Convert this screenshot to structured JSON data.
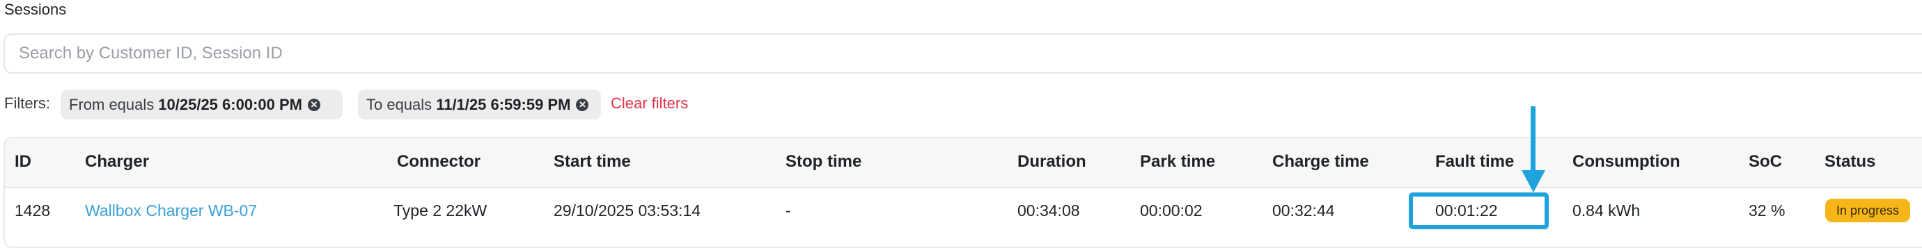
{
  "page": {
    "title": "Sessions"
  },
  "search": {
    "placeholder": "Search by Customer ID, Session ID",
    "value": ""
  },
  "filters": {
    "label": "Filters:",
    "chips": [
      {
        "field": "From equals",
        "value": "10/25/25 6:00:00 PM",
        "remove_icon": "close-circle-icon"
      },
      {
        "field": "To equals",
        "value": "11/1/25 6:59:59 PM",
        "remove_icon": "close-circle-icon"
      }
    ],
    "clear_label": "Clear filters"
  },
  "table": {
    "columns": [
      "ID",
      "Charger",
      "Connector",
      "Start time",
      "Stop time",
      "Duration",
      "Park time",
      "Charge time",
      "Fault time",
      "Consumption",
      "SoC",
      "Status"
    ],
    "rows": [
      {
        "id": "1428",
        "charger": "Wallbox Charger WB-07",
        "connector": "Type 2 22kW",
        "start_time": "29/10/2025 03:53:14",
        "stop_time": "-",
        "duration": "00:34:08",
        "park_time": "00:00:02",
        "charge_time": "00:32:44",
        "fault_time": "00:01:22",
        "consumption": "0.84 kWh",
        "soc": "32 %",
        "status": "In progress"
      }
    ]
  },
  "colors": {
    "link": "#3aa0d8",
    "clear_filters": "#e0334a",
    "status_in_progress": "#f6b619",
    "annotation": "#1ea3dc"
  },
  "annotation": {
    "highlight": "fault-time-cell",
    "arrow_icon": "arrow-down-icon"
  }
}
